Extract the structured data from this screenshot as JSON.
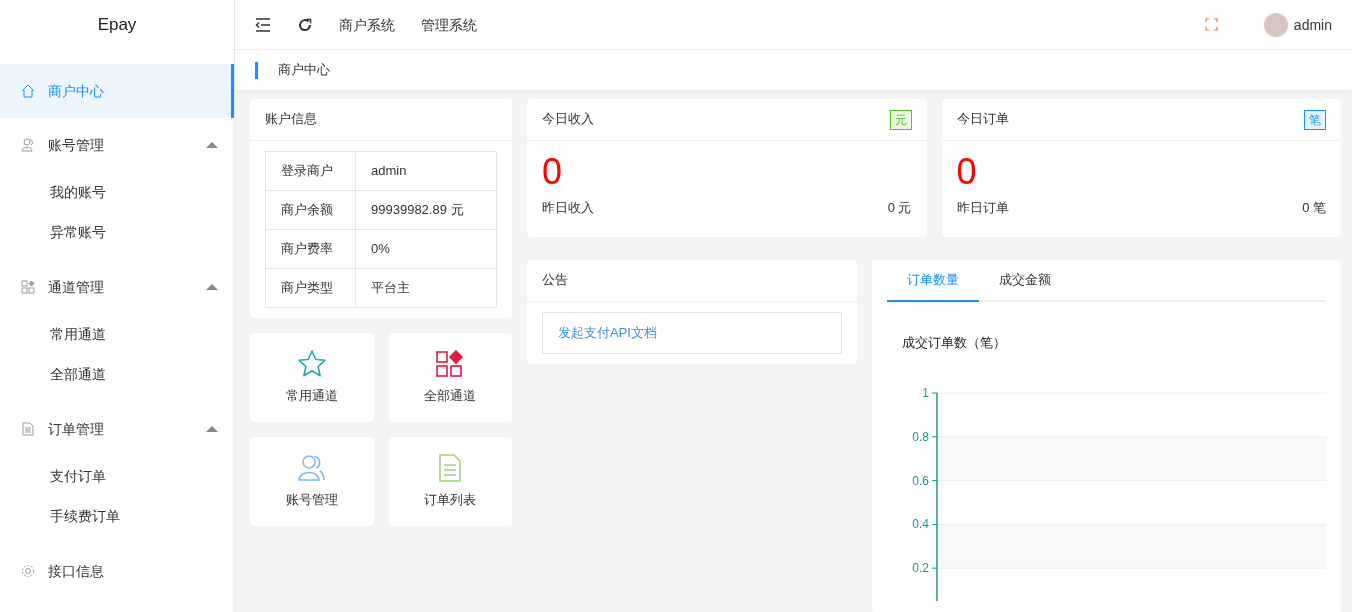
{
  "brand": "Epay",
  "sidebar": {
    "items": [
      {
        "label": "商户中心",
        "kind": "home",
        "selected": true
      },
      {
        "label": "账号管理",
        "kind": "user",
        "selected": false,
        "expanded": true,
        "children": [
          {
            "label": "我的账号",
            "selected": false
          },
          {
            "label": "异常账号",
            "selected": false
          }
        ]
      },
      {
        "label": "通道管理",
        "kind": "apps",
        "selected": false,
        "expanded": true,
        "children": [
          {
            "label": "常用通道",
            "selected": false
          },
          {
            "label": "全部通道",
            "selected": false
          }
        ]
      },
      {
        "label": "订单管理",
        "kind": "doc",
        "selected": false,
        "expanded": true,
        "children": [
          {
            "label": "支付订单",
            "selected": false
          },
          {
            "label": "手续费订单",
            "selected": false
          }
        ]
      },
      {
        "label": "接口信息",
        "kind": "gear",
        "selected": false
      }
    ]
  },
  "header": {
    "nav_links": [
      "商户系统",
      "管理系统"
    ],
    "user": "admin"
  },
  "breadcrumb": "商户中心",
  "account": {
    "title": "账户信息",
    "rows": [
      {
        "label": "登录商户",
        "value": "admin"
      },
      {
        "label": "商户余额",
        "value": "99939982.89 元"
      },
      {
        "label": "商户费率",
        "value": "0%"
      },
      {
        "label": "商户类型",
        "value": "平台主"
      }
    ]
  },
  "shortcuts": [
    {
      "label": "常用通道",
      "kind": "star"
    },
    {
      "label": "全部通道",
      "kind": "grid"
    },
    {
      "label": "账号管理",
      "kind": "users"
    },
    {
      "label": "订单列表",
      "kind": "list"
    }
  ],
  "stats": [
    {
      "title": "今日收入",
      "badge": "元",
      "color": "#52c41a",
      "value": "0",
      "sub_label": "昨日收入",
      "sub_value": "0 元"
    },
    {
      "title": "今日订单",
      "badge": "笔",
      "color": "#1890ff",
      "value": "0",
      "sub_label": "昨日订单",
      "sub_value": "0 笔"
    }
  ],
  "notice": {
    "title": "公告",
    "link": "发起支付API文档"
  },
  "chart_card": {
    "tabs": [
      {
        "label": "订单数量",
        "selected": true
      },
      {
        "label": "成交金额",
        "selected": false
      }
    ],
    "chart_data": {
      "type": "line",
      "title": "成交订单数（笔）",
      "categories": [
        null
      ],
      "grid": true,
      "ylim": [
        0.05,
        1
      ],
      "yticks": [
        0.2,
        0.4,
        0.6,
        0.8,
        1
      ]
    }
  }
}
